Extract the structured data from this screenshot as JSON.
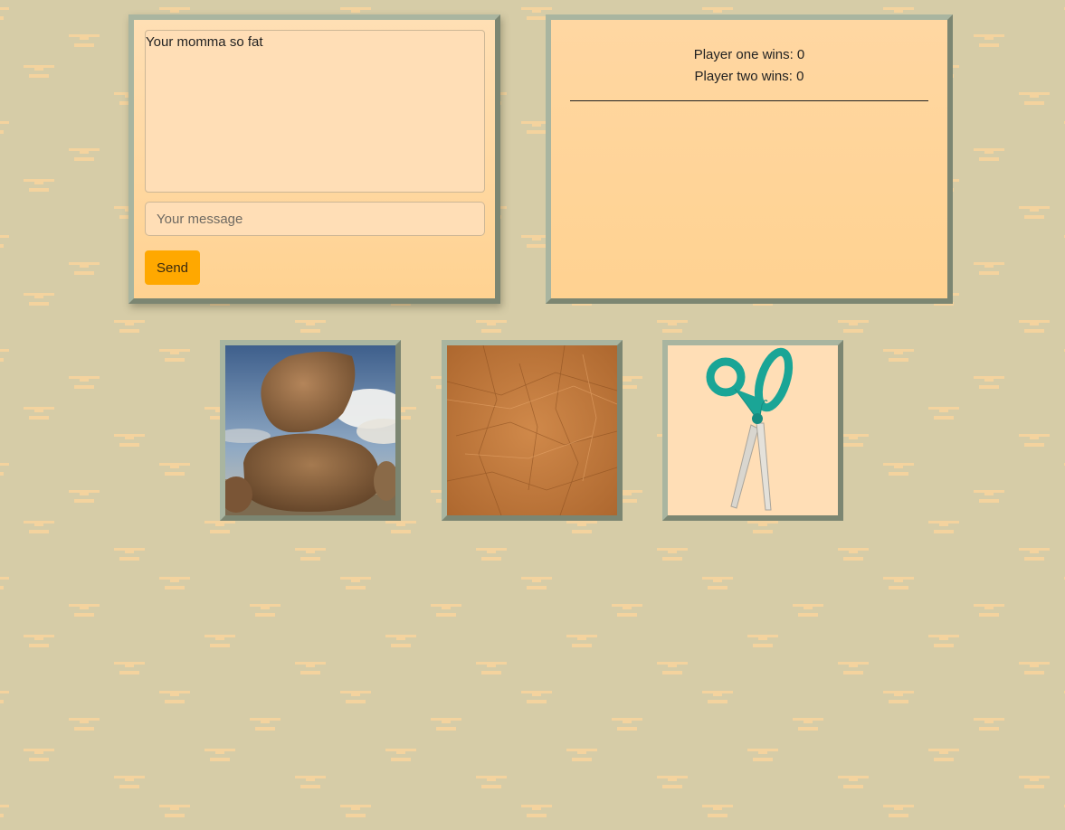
{
  "chat": {
    "log_text": "Your momma so fat",
    "input_value": "",
    "input_placeholder": "Your message",
    "send_label": "Send"
  },
  "scoreboard": {
    "player_one": "Player one wins: 0",
    "player_two": "Player two wins: 0"
  },
  "choices": [
    {
      "id": "rock",
      "icon": "rock-image"
    },
    {
      "id": "paper",
      "icon": "paper-image"
    },
    {
      "id": "scissors",
      "icon": "scissors-image"
    }
  ],
  "colors": {
    "background": "#d6cca7",
    "pattern": "#f5d4a0",
    "panel": "#ffd291",
    "frame_light": "#a9b5a0",
    "frame_dark": "#7c8672",
    "send_button": "#ffa800",
    "input_bg": "#ffdeb6"
  }
}
